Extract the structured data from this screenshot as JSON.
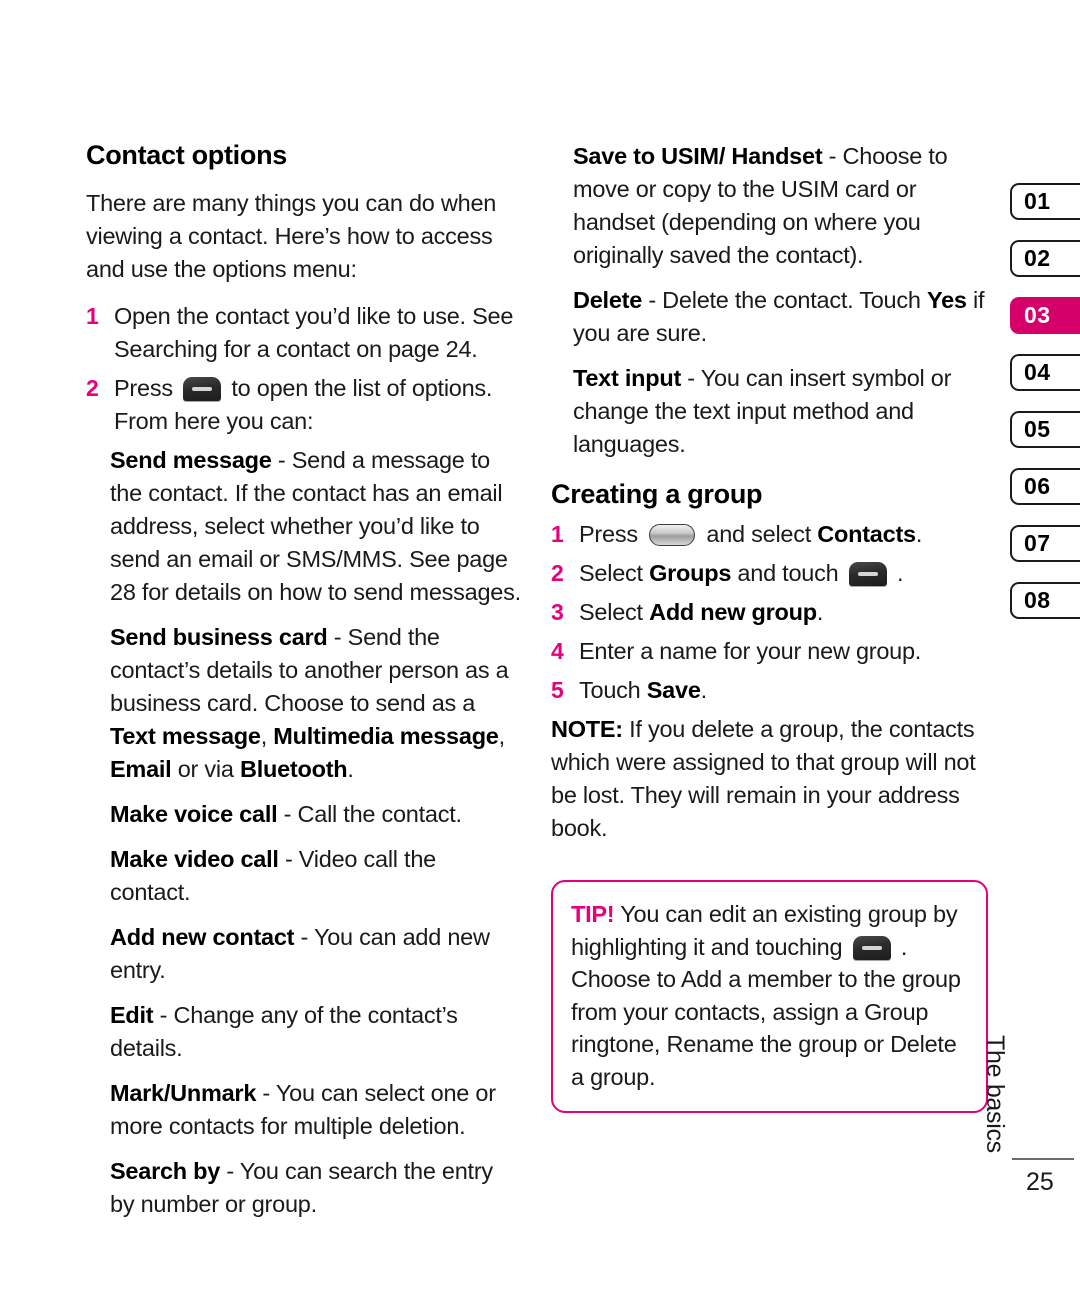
{
  "colors": {
    "accent_magenta": "#E4007E",
    "tab_active": "#D6006B",
    "text": "#1a1a1a"
  },
  "left_column": {
    "section_title": "Contact options",
    "intro": "There are many things you can do when viewing a contact. Here’s how to access and use the options menu:",
    "steps": [
      {
        "num": "1",
        "text_before": "Open the contact you’d like to use. See Searching for a contact on page 24.",
        "icon": null,
        "text_after": ""
      },
      {
        "num": "2",
        "text_before": "Press ",
        "icon": "dark-key-icon",
        "text_after": " to open the list of options. From here you can:"
      }
    ],
    "options": [
      {
        "term": "Send message",
        "desc": " - Send a message to the contact. If the contact has an email address, select whether you’d like to send an email or SMS/MMS. See page 28 for details on how to send messages."
      },
      {
        "term": "Send business card",
        "desc": " - Send the contact’s details to another person as a business card. Choose to send as a ",
        "bold_runs": [
          "Text message",
          "Multimedia message",
          "Email",
          "Bluetooth"
        ],
        "tail": ", ",
        "tail2": " or via ",
        "tail3": "."
      },
      {
        "term": "Make voice call",
        "desc": " - Call the contact."
      },
      {
        "term": "Make video call",
        "desc": " - Video call the contact."
      },
      {
        "term": "Add new contact",
        "desc": " - You can add new entry."
      },
      {
        "term": "Edit",
        "desc": " - Change any of the contact’s details."
      },
      {
        "term": "Mark/Unmark",
        "desc": " - You can select one or more contacts for multiple deletion."
      },
      {
        "term": "Search by",
        "desc": " - You can search the entry by number or group."
      }
    ]
  },
  "right_column": {
    "options": [
      {
        "term": "Save to USIM/ Handset",
        "desc": " - Choose to move or copy to the USIM card or handset (depending on where you originally saved the contact)."
      },
      {
        "term": "Delete",
        "desc_a": " - Delete the contact. Touch ",
        "desc_bold": "Yes",
        "desc_b": " if you are sure."
      },
      {
        "term": "Text input",
        "desc": " - You can insert symbol or change the text input method and languages."
      }
    ],
    "section_title": "Creating a group",
    "steps": [
      {
        "num": "1",
        "pre": "Press ",
        "icon": "silver-key-icon",
        "mid": " and select ",
        "bold": "Contacts",
        "post": "."
      },
      {
        "num": "2",
        "pre": "Select ",
        "bold": "Groups",
        "mid": " and touch ",
        "icon": "dark-key-icon",
        "post": " ."
      },
      {
        "num": "3",
        "pre": "Select ",
        "bold": "Add new group",
        "post": "."
      },
      {
        "num": "4",
        "pre": "Enter a name for your new group.",
        "bold": "",
        "post": ""
      },
      {
        "num": "5",
        "pre": "Touch ",
        "bold": "Save",
        "post": "."
      }
    ],
    "note_label": "NOTE:",
    "note_text": " If you delete a group, the contacts which were assigned to that group will not be lost. They will remain in your address book."
  },
  "tip_box": {
    "label": "TIP!",
    "text_a": " You can edit an existing group by highlighting it and touching ",
    "icon": "dark-key-icon",
    "text_b": " . Choose to Add a member to the group from your contacts, assign a Group ringtone, Rename the group or Delete a group."
  },
  "tabs": [
    {
      "label": "01",
      "active": false
    },
    {
      "label": "02",
      "active": false
    },
    {
      "label": "03",
      "active": true
    },
    {
      "label": "04",
      "active": false
    },
    {
      "label": "05",
      "active": false
    },
    {
      "label": "06",
      "active": false
    },
    {
      "label": "07",
      "active": false
    },
    {
      "label": "08",
      "active": false
    }
  ],
  "footer": {
    "chapter_label": "The basics",
    "page_number": "25"
  }
}
